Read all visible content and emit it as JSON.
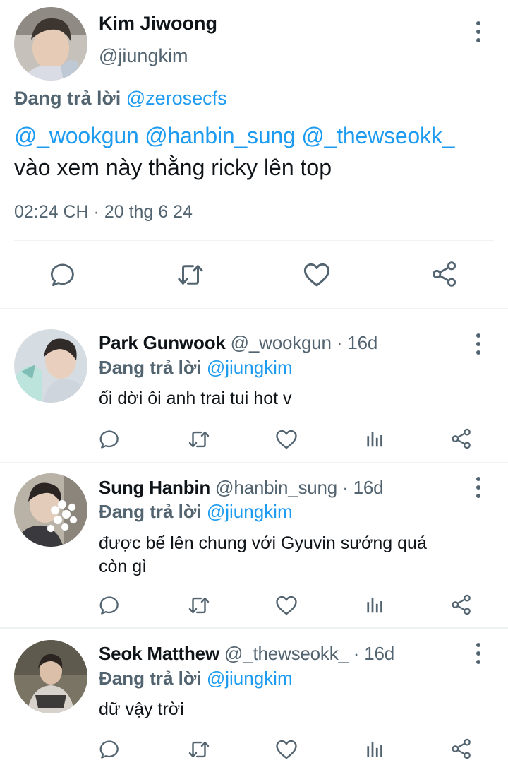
{
  "main_tweet": {
    "display_name": "Kim Jiwoong",
    "handle": "@jiungkim",
    "replying_prefix": "Đang trả lời",
    "replying_to": "@zerosecfs",
    "mentions": [
      "@_wookgun",
      "@hanbin_sung",
      "@_thewseokk_"
    ],
    "text": "vào xem này thằng ricky lên top",
    "timestamp": "02:24 CH · 20 thg 6 24"
  },
  "replies": [
    {
      "display_name": "Park Gunwook",
      "handle": "@_wookgun",
      "age": "· 16d",
      "replying_prefix": "Đang trả lời",
      "replying_to": "@jiungkim",
      "text": "ối dời ôi anh trai tui hot v"
    },
    {
      "display_name": "Sung Hanbin",
      "handle": "@hanbin_sung",
      "age": "· 16d",
      "replying_prefix": "Đang trả lời",
      "replying_to": "@jiungkim",
      "text_line1": "được bế lên chung với Gyuvin sướng quá",
      "text_line2": "còn gì"
    },
    {
      "display_name": "Seok Matthew",
      "handle": "@_thewseokk_",
      "age": "· 16d",
      "replying_prefix": "Đang trả lời",
      "replying_to": "@jiungkim",
      "text": "dữ vậy trời"
    }
  ],
  "colors": {
    "link": "#1d9bf0",
    "secondary_text": "#536471",
    "primary_text": "#0f1419",
    "divider": "#eff3f4"
  },
  "icons": [
    "reply-icon",
    "retweet-icon",
    "like-icon",
    "views-icon",
    "share-icon",
    "more-options-icon"
  ]
}
